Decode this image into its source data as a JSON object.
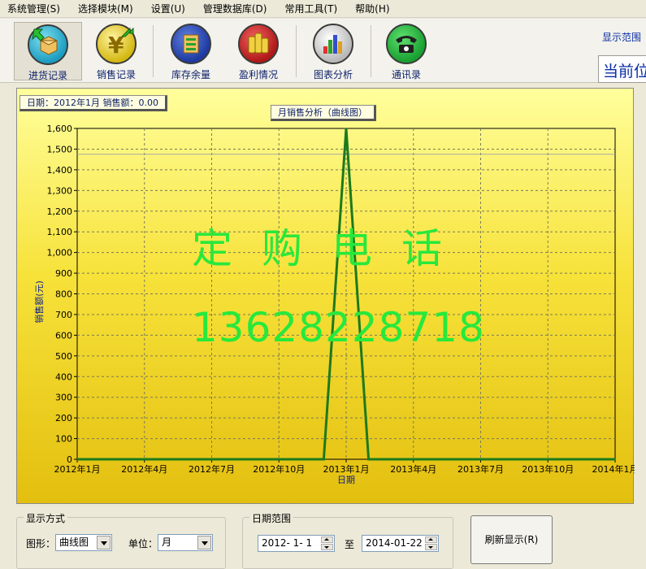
{
  "menu": [
    "系统管理(S)",
    "选择模块(M)",
    "设置(U)",
    "管理数据库(D)",
    "常用工具(T)",
    "帮助(H)"
  ],
  "toolbar": {
    "items": [
      {
        "label": "进货记录",
        "icon": "box-import-icon",
        "color": "#1c9cc0"
      },
      {
        "label": "销售记录",
        "icon": "yen-export-icon",
        "color": "#d4b812"
      },
      {
        "label": "库存余量",
        "icon": "inventory-icon",
        "color": "#1e3aa0"
      },
      {
        "label": "盈利情况",
        "icon": "coins-icon",
        "color": "#b01818"
      },
      {
        "label": "图表分析",
        "icon": "chart-icon",
        "color": "#b8b8b8"
      },
      {
        "label": "通讯录",
        "icon": "telephone-icon",
        "color": "#18a030"
      }
    ],
    "range_label": "显示范围",
    "current_label": "当前位置"
  },
  "info": "日期：2012年1月  销售额：0.00",
  "chart_title": "月销售分析（曲线图）",
  "watermark": {
    "line1": "定购电话",
    "line2": "13628228718"
  },
  "chart_data": {
    "type": "line",
    "xlabel": "日期",
    "ylabel": "销售额(元)",
    "ylim": [
      0,
      1600
    ],
    "yticks": [
      "0",
      "100",
      "200",
      "300",
      "400",
      "500",
      "600",
      "700",
      "800",
      "900",
      "1,000",
      "1,100",
      "1,200",
      "1,300",
      "1,400",
      "1,500",
      "1,600"
    ],
    "xticks": [
      "2012年1月",
      "2012年4月",
      "2012年7月",
      "2012年10月",
      "2013年1月",
      "2013年4月",
      "2013年7月",
      "2013年10月",
      "2014年1月"
    ],
    "x_months": [
      0,
      3,
      6,
      9,
      12,
      15,
      18,
      21,
      24
    ],
    "grid": true,
    "reference_y": 1475,
    "series": [
      {
        "color": "#1c7a1c",
        "points": [
          [
            0,
            0
          ],
          [
            11,
            0
          ],
          [
            12,
            1600
          ],
          [
            13,
            0
          ],
          [
            24,
            0
          ]
        ]
      }
    ]
  },
  "display_mode": {
    "title": "显示方式",
    "shape_label": "图形：",
    "shape_value": "曲线图",
    "unit_label": "单位：",
    "unit_value": "月"
  },
  "date_range": {
    "title": "日期范围",
    "start": "2012- 1- 1",
    "to": "至",
    "end": "2014-01-22"
  },
  "refresh_label": "刷新显示(R)"
}
